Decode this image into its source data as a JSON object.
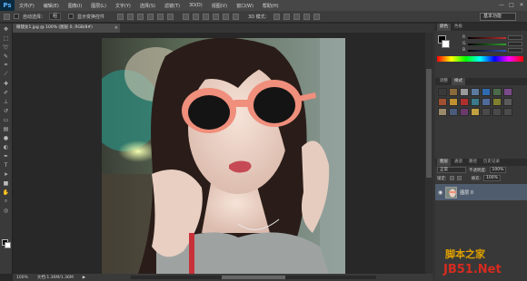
{
  "app": {
    "logo": "Ps"
  },
  "menu": [
    "文件(F)",
    "编辑(E)",
    "图像(I)",
    "图层(L)",
    "文字(Y)",
    "选择(S)",
    "滤镜(T)",
    "3D(D)",
    "视图(V)",
    "窗口(W)",
    "帮助(H)"
  ],
  "window_controls": [
    "—",
    "□",
    "✕"
  ],
  "options": {
    "auto_select_label": "自动选择：",
    "auto_select_value": "组",
    "show_transform_label": "显示变换控件",
    "mode_3d_label": "3D 模式：",
    "workspace": "基本功能"
  },
  "document": {
    "tab_title": "眼镜女1.jpg @ 100% (图层 0, RGB/8#)",
    "close": "×"
  },
  "status": {
    "zoom": "100%",
    "doc_size": "文档:1.36M/1.36M"
  },
  "panels": {
    "color_tabs": [
      "颜色",
      "色板"
    ],
    "slider_letters": [
      "R",
      "G",
      "B"
    ],
    "adjust_tabs": [
      "调整",
      "样式"
    ],
    "layer_tabs": [
      "图层",
      "通道",
      "路径",
      "历史记录"
    ],
    "kind_label": "正常",
    "opacity_label": "不透明度:",
    "opacity_value": "100%",
    "lock_label": "锁定:",
    "fill_label": "填充:",
    "fill_value": "100%",
    "layer_name": "图层 0"
  },
  "watermark": {
    "line1": "脚本之家",
    "line2": "JB51.Net"
  },
  "colors": {
    "foreground": "#000000",
    "background": "#ffffff",
    "slider_r": "#c03030",
    "slider_g": "#30a030",
    "slider_b": "#3050c0"
  },
  "icons": [
    "move-tool-icon",
    "marquee-tool-icon",
    "lasso-tool-icon",
    "quick-select-icon",
    "crop-tool-icon",
    "eyedropper-icon",
    "healing-brush-icon",
    "brush-tool-icon",
    "clone-stamp-icon",
    "history-brush-icon",
    "eraser-icon",
    "gradient-icon",
    "blur-icon",
    "dodge-icon",
    "pen-tool-icon",
    "type-tool-icon",
    "path-select-icon",
    "shape-tool-icon",
    "hand-tool-icon",
    "zoom-tool-icon"
  ]
}
